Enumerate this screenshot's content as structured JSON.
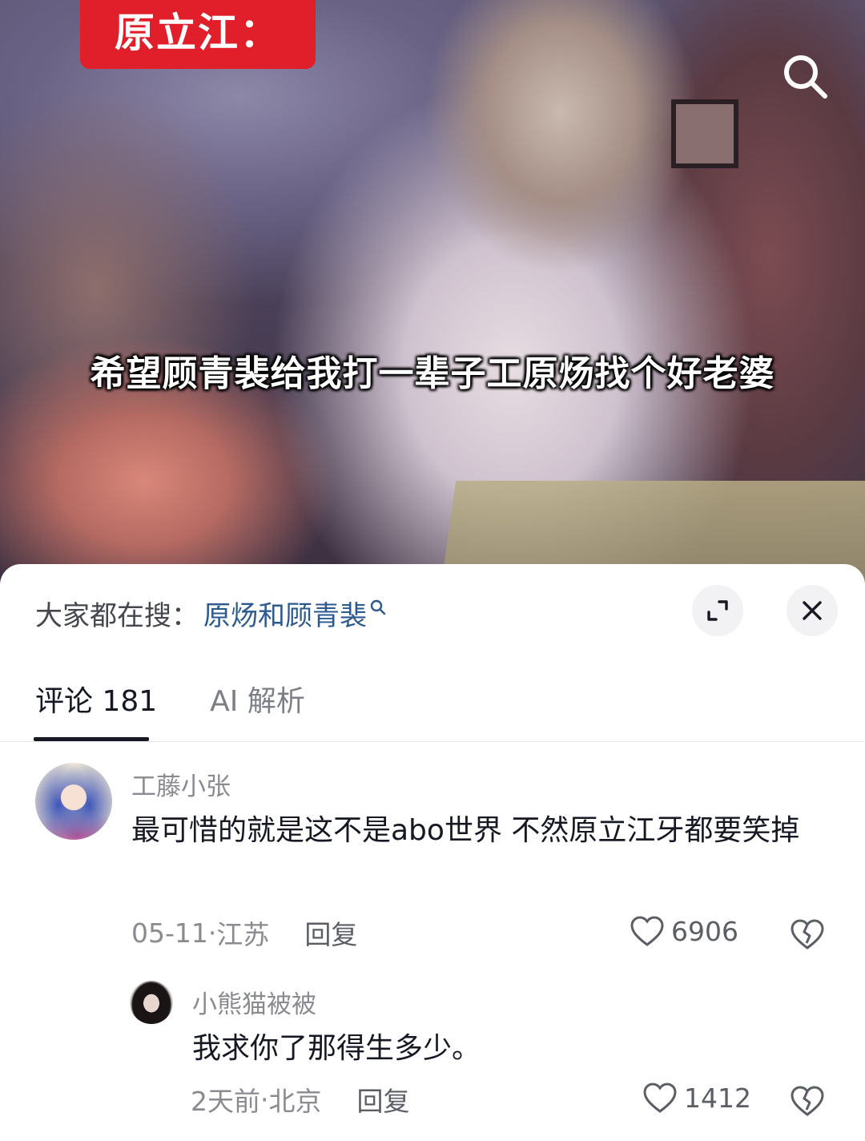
{
  "video": {
    "label_tag": "原立江：",
    "subtitle": "希望顾青裴给我打一辈子工原炀找个好老婆",
    "search_icon": "search-icon"
  },
  "search_bar": {
    "prefix": "大家都在搜：",
    "term": "原炀和顾青裴",
    "expand_icon": "expand-icon",
    "close_icon": "close-icon"
  },
  "tabs": [
    {
      "label": "评论 181",
      "active": true
    },
    {
      "label": "AI 解析",
      "active": false
    }
  ],
  "comments": [
    {
      "username": "工藤小张",
      "text": "最可惜的就是这不是abo世界 不然原立江牙都要笑掉",
      "date": "05-11",
      "location": "江苏",
      "reply_label": "回复",
      "likes": "6906"
    },
    {
      "username": "小熊猫被被",
      "text": "我求你了那得生多少。",
      "date": "2天前",
      "location": "北京",
      "reply_label": "回复",
      "likes": "1412"
    }
  ],
  "meta_separator": " · ",
  "colors": {
    "accent_red": "#e01f2a",
    "search_term": "#2d5a8e",
    "muted_text": "#8a8b91"
  }
}
